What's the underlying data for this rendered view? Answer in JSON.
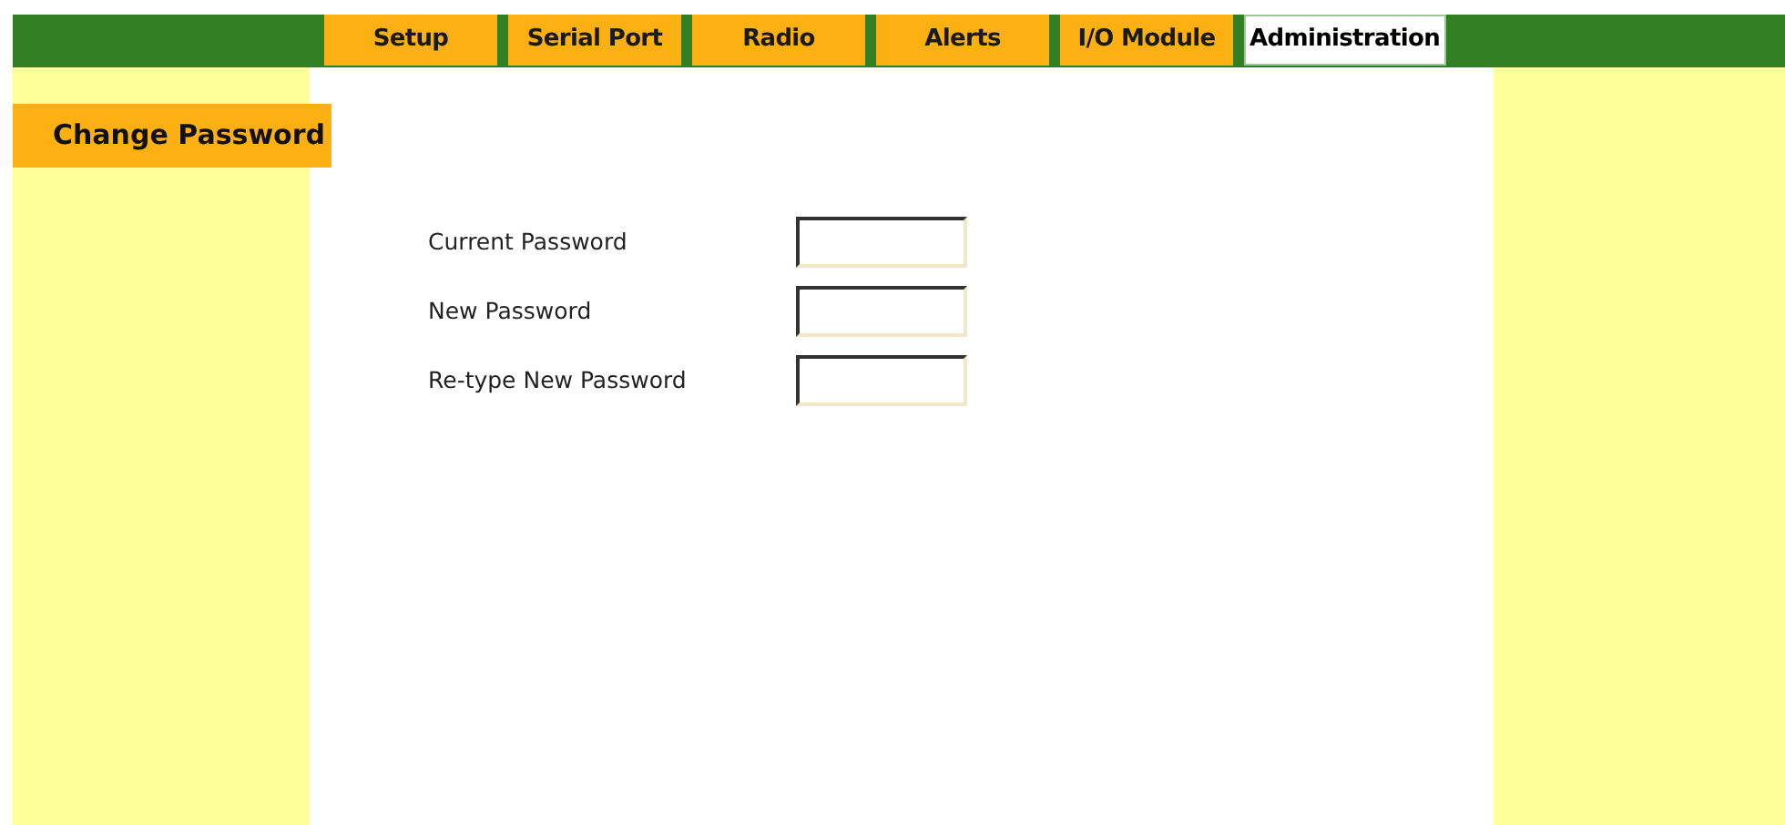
{
  "tabs": [
    {
      "label": "Setup",
      "selected": false
    },
    {
      "label": "Serial Port",
      "selected": false
    },
    {
      "label": "Radio",
      "selected": false
    },
    {
      "label": "Alerts",
      "selected": false
    },
    {
      "label": "I/O Module",
      "selected": false
    },
    {
      "label": "Administration",
      "selected": true
    }
  ],
  "sidebar": {
    "items": [
      {
        "label": "Change Password",
        "selected": true
      }
    ]
  },
  "form": {
    "fields": [
      {
        "label": "Current Password"
      },
      {
        "label": "New Password"
      },
      {
        "label": "Re-type New Password"
      }
    ]
  }
}
